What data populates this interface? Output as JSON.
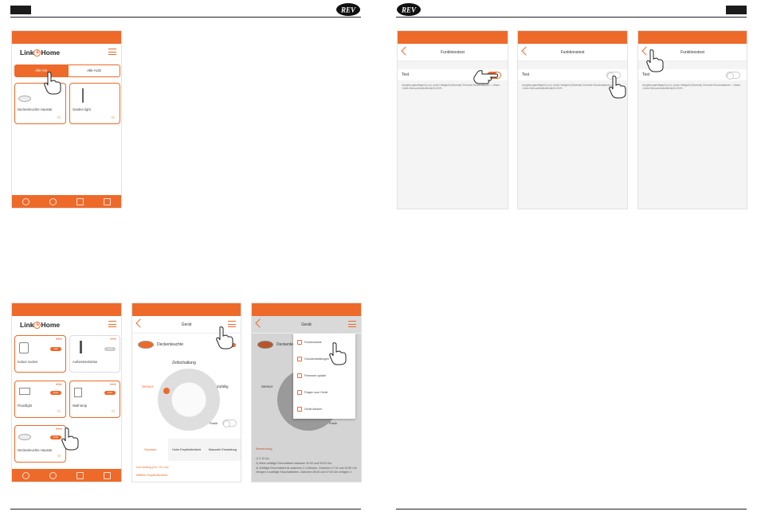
{
  "brand": "REV",
  "app": {
    "logo_text": "Link",
    "logo_mid": "a",
    "logo_end": "Home"
  },
  "screen_a": {
    "btn_all_on": "Alle AN",
    "btn_all_off": "Alle AUS",
    "device1": "Deckenleuchte Haustür",
    "device2": "Garden light"
  },
  "test_screens": {
    "title": "Funktionstest",
    "row_label": "Test",
    "description": "Umgebungshelligkeit (Lux) <jede Helligkeit (Maximal) Kürzeste Einschaltdauer = 15sek.<2sek.Sensorempfindlichkeit=100%"
  },
  "screen_d": {
    "device1": "Indoor socket",
    "device1_state": "AN",
    "device2": "Außensteckdose",
    "device2_state": "AUS",
    "device3": "Floodlight",
    "device3_state": "Auto",
    "device4": "Wall lamp",
    "device4_state": "Auto",
    "device5": "Deckenleuchte Haustür",
    "device5_state": "Auto"
  },
  "screen_e": {
    "title": "Gerät",
    "device": "Deckenleuchte",
    "device_state": "Auto",
    "timer_label": "Zeitschaltung",
    "sensor_label": "Sensor",
    "random_label": "Zufällig",
    "panic_label": "Panik",
    "tabs": [
      "Standard",
      "Hohe Empfindlichkeit",
      "Manuelle Einstellung"
    ],
    "line1": "Lux niedrig (Ca. 10 Lux)",
    "line2": "Mittlere Empfindlichkeit"
  },
  "screen_f": {
    "title": "Gerät",
    "device": "Deckenleuchte",
    "menu": [
      "Funktionstest",
      "Grundeinstellungen",
      "Firmware update",
      "Fragen zum Gerät",
      "Gerät löschen"
    ],
    "sensor_label": "Sensor",
    "panic_label": "Panik",
    "note_title": "Bemerkung",
    "note_lines": [
      "1) 0-10 lux,",
      "2) keine zufällige Einschaltzeit zwischen 00:00 und 05:00 Uhr.",
      "3) Zufällige Einschaltzeit ist zwischen 2-4 Minuten. Zwischen 17:01 und 23:59 Uhr erfolgen 4 zufällige Einschaltzeiten. Zwischen 05:00 und 07:00 Uhr erfolgen 2"
    ]
  },
  "colors": {
    "accent": "#ee6a2a"
  }
}
